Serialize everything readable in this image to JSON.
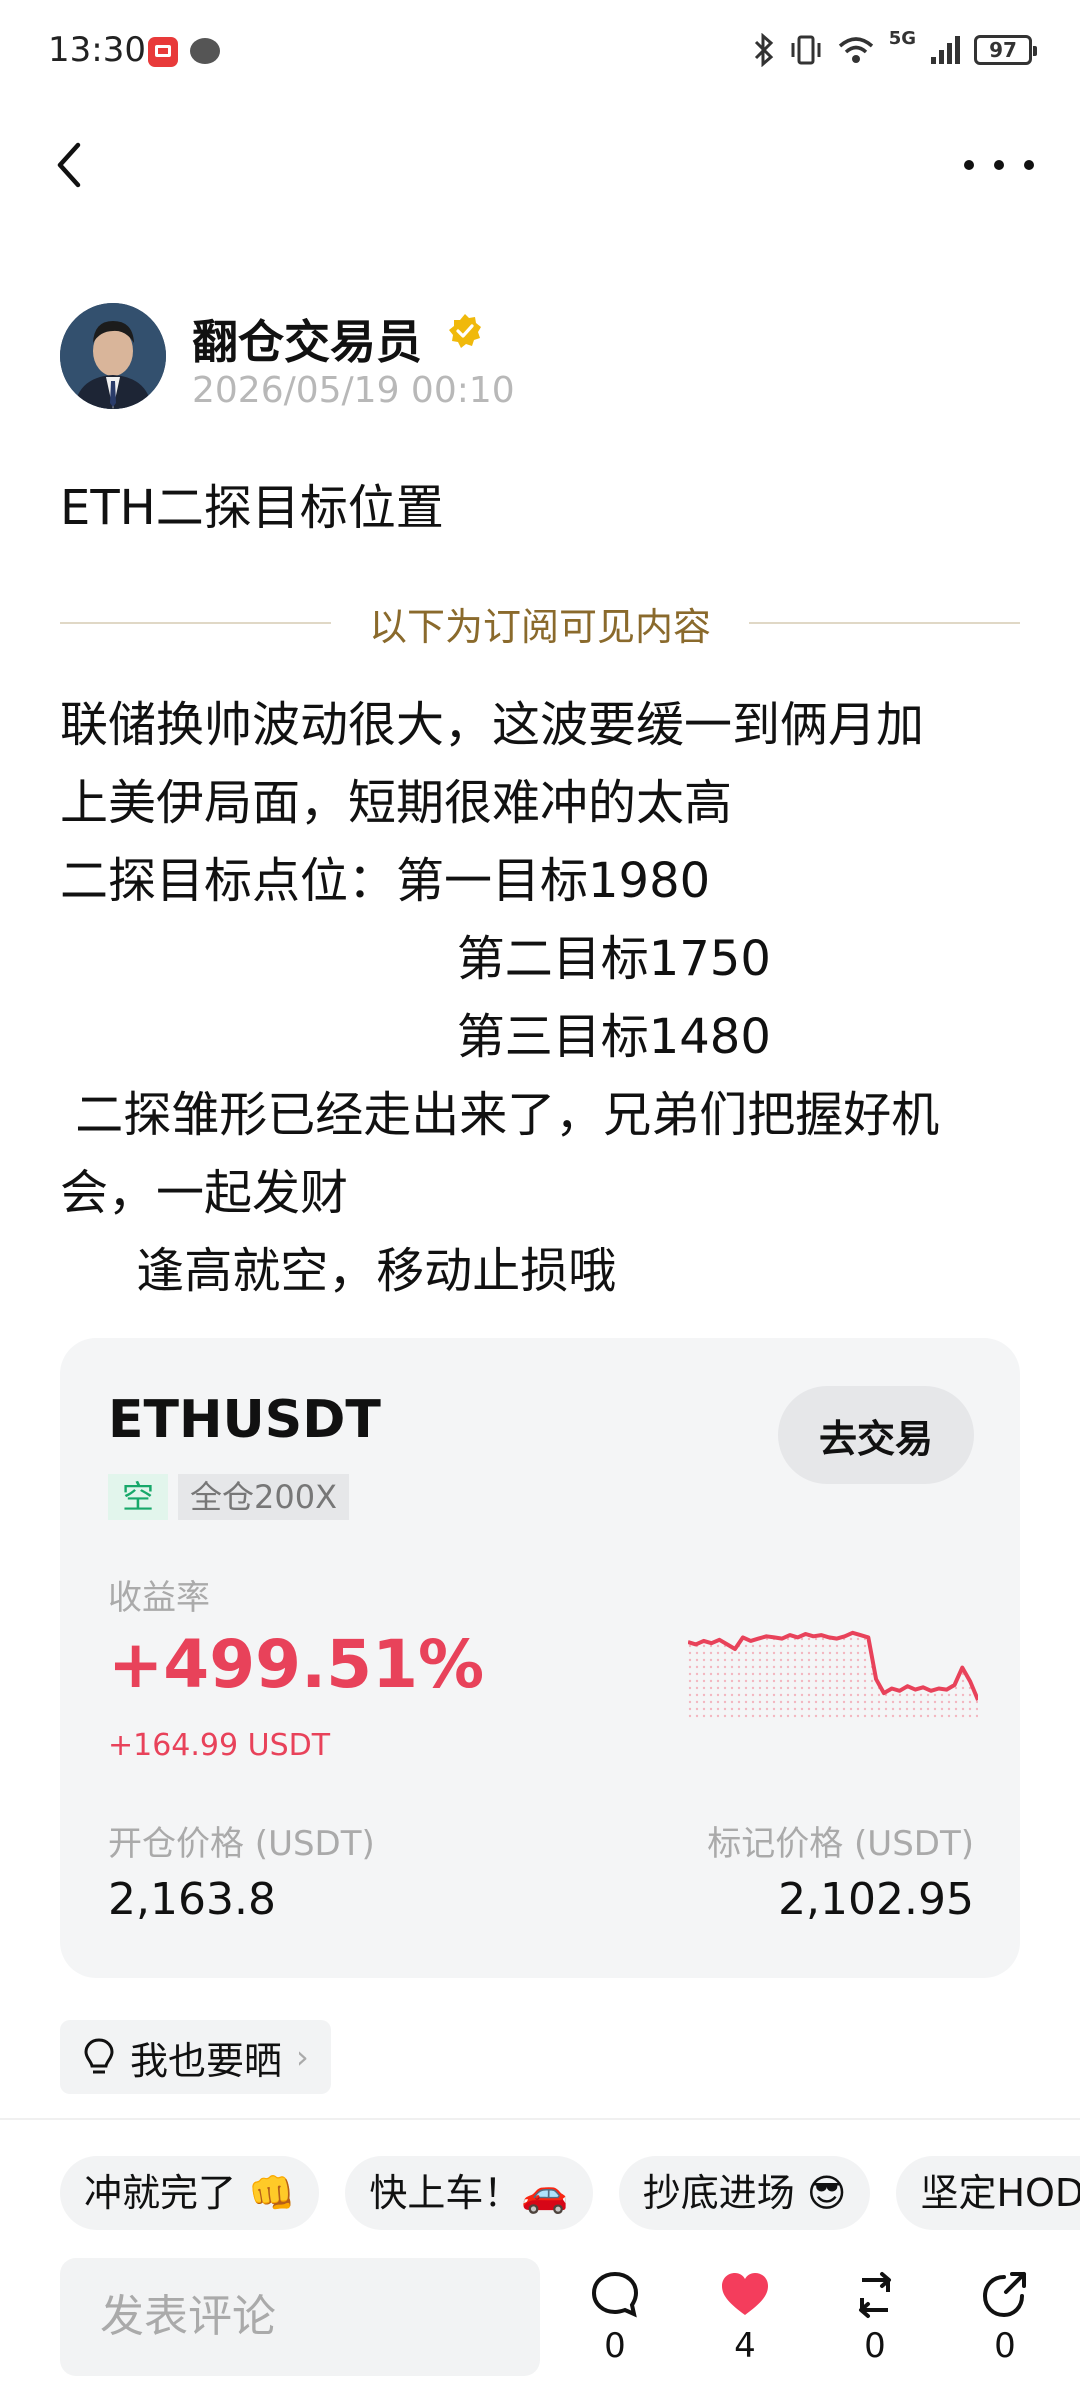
{
  "status_bar": {
    "time": "13:30",
    "network": "5G",
    "battery": "97"
  },
  "post": {
    "author": "翻仓交易员",
    "time": "2026/05/19 00:10",
    "title": "ETH二探目标位置",
    "subscribe_divider": "以下为订阅可见内容",
    "body_lines": [
      "联储换帅波动很大，这波要缓一到俩月加",
      "上美伊局面，短期很难冲的太高",
      "二探目标点位：第一目标1980",
      "                          第二目标1750",
      "                          第三目标1480",
      " 二探雏形已经走出来了，兄弟们把握好机",
      "会，一起发财",
      "     逢高就空，移动止损哦"
    ]
  },
  "trade_card": {
    "symbol": "ETHUSDT",
    "trade_button": "去交易",
    "direction": "空",
    "margin_mode": "全仓200X",
    "roi_label": "收益率",
    "roi_value": "+499.51%",
    "pnl_value": "+164.99 USDT",
    "open_price_label": "开仓价格 (USDT)",
    "open_price": "2,163.8",
    "mark_price_label": "标记价格 (USDT)",
    "mark_price": "2,102.95",
    "sparkline": [
      0.62,
      0.6,
      0.63,
      0.61,
      0.64,
      0.6,
      0.56,
      0.66,
      0.63,
      0.65,
      0.67,
      0.66,
      0.65,
      0.68,
      0.66,
      0.69,
      0.67,
      0.68,
      0.66,
      0.65,
      0.67,
      0.7,
      0.68,
      0.66,
      0.3,
      0.18,
      0.22,
      0.2,
      0.24,
      0.21,
      0.23,
      0.2,
      0.22,
      0.21,
      0.25,
      0.4,
      0.28,
      0.12
    ],
    "accent_color": "#e8425a"
  },
  "share_button": "我也要晒",
  "quick_replies": [
    "冲就完了 👊",
    "快上车！🚗",
    "抄底进场 😎",
    "坚定HODL"
  ],
  "comment_placeholder": "发表评论",
  "actions": {
    "comment_count": "0",
    "like_count": "4",
    "repost_count": "0",
    "share_count": "0"
  }
}
